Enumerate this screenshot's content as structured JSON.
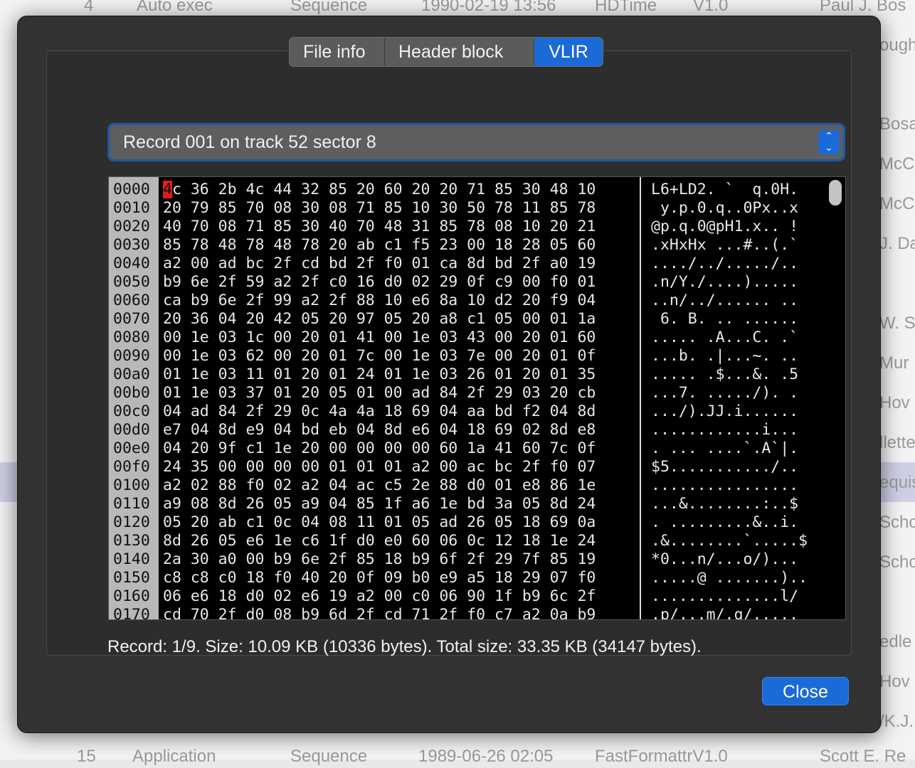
{
  "background_window": {
    "top_row": [
      "4",
      "Auto exec",
      "Sequence",
      "1990-02-19 13:56",
      "HDTime",
      "V1.0",
      "Paul J. Bos"
    ],
    "bottom_row": [
      "15",
      "Application",
      "Sequence",
      "1989-06-26 02:05",
      "FastFormattrV1.0",
      "Scott E. Re"
    ],
    "right_fragments": [
      "ough",
      "Bosa",
      "McCo",
      "McCo",
      "J. Da",
      "W. S",
      "Mur",
      "Hov",
      "llette",
      "equis",
      "Scho",
      "Scho",
      "edle",
      "Hov",
      "/K.J."
    ]
  },
  "dialog": {
    "tabs": [
      {
        "label": "File info",
        "active": false
      },
      {
        "label": "Header block",
        "active": false
      },
      {
        "label": "VLIR",
        "active": true
      }
    ],
    "record_select": {
      "selected": "Record 001 on track 52 sector 8",
      "stepper_up": "⌃",
      "stepper_down": "⌄"
    },
    "hex": {
      "offsets": [
        "0000",
        "0010",
        "0020",
        "0030",
        "0040",
        "0050",
        "0060",
        "0070",
        "0080",
        "0090",
        "00a0",
        "00b0",
        "00c0",
        "00d0",
        "00e0",
        "00f0",
        "0100",
        "0110",
        "0120",
        "0130",
        "0140",
        "0150",
        "0160",
        "0170"
      ],
      "cursor_char": "4",
      "first_row_rest": "c 36 2b 4c 44 32 85 20 60 20 20 71 85 30 48 10",
      "bytes_rest": [
        "20 79 85 70 08 30 08 71 85 10 30 50 78 11 85 78",
        "40 70 08 71 85 30 40 70 48 31 85 78 08 10 20 21",
        "85 78 48 78 48 78 20 ab c1 f5 23 00 18 28 05 60",
        "a2 00 ad bc 2f cd bd 2f f0 01 ca 8d bd 2f a0 19",
        "b9 6e 2f 59 a2 2f c0 16 d0 02 29 0f c9 00 f0 01",
        "ca b9 6e 2f 99 a2 2f 88 10 e6 8a 10 d2 20 f9 04",
        "20 36 04 20 42 05 20 97 05 20 a8 c1 05 00 01 1a",
        "00 1e 03 1c 00 20 01 41 00 1e 03 43 00 20 01 60",
        "00 1e 03 62 00 20 01 7c 00 1e 03 7e 00 20 01 0f",
        "01 1e 03 11 01 20 01 24 01 1e 03 26 01 20 01 35",
        "01 1e 03 37 01 20 05 01 00 ad 84 2f 29 03 20 cb",
        "04 ad 84 2f 29 0c 4a 4a 18 69 04 aa bd f2 04 8d",
        "e7 04 8d e9 04 bd eb 04 8d e6 04 18 69 02 8d e8",
        "04 20 9f c1 1e 20 00 00 00 00 60 1a 41 60 7c 0f",
        "24 35 00 00 00 00 01 01 01 a2 00 ac bc 2f f0 07",
        "a2 02 88 f0 02 a2 04 ac c5 2e 88 d0 01 e8 86 1e",
        "a9 08 8d 26 05 a9 04 85 1f a6 1e bd 3a 05 8d 24",
        "05 20 ab c1 0c 04 08 11 01 05 ad 26 05 18 69 0a",
        "8d 26 05 e6 1e c6 1f d0 e0 60 06 0c 12 18 1e 24",
        "2a 30 a0 00 b9 6e 2f 85 18 b9 6f 2f 29 7f 85 19",
        "c8 c8 c0 18 f0 40 20 0f 09 b0 e9 a5 18 29 07 f0",
        "06 e6 18 d0 02 e6 19 a2 00 c0 06 90 1f b9 6c 2f",
        "cd 70 2f d0 08 b9 6d 2f cd 71 2f f0 c7 a2 0a b9"
      ],
      "ascii": [
        "L6+LD2. `  q.0H.",
        " y.p.0.q..0Px..x",
        "@p.q.0@pH1.x.. !",
        ".xHxHx ...#..(.`",
        "..../../...../..",
        ".n/Y./....).....",
        "..n/../...... ..",
        " 6. B. .. ......",
        "..... .A...C. .`",
        "...b. .|...~. ..",
        "..... .$...&. .5",
        "...7. ...../). .",
        ".../).JJ.i......",
        "............i...",
        ". ... ....`.A`|.",
        "$5.........../..",
        "................",
        "...&........:..$",
        ". .........&..i.",
        ".&........`.....$",
        "*0...n/...o/)...",
        ".....@ .......)..",
        "..............l/",
        ".p/...m/.q/....."
      ]
    },
    "status": "Record: 1/9. Size: 10.09 KB (10336 bytes). Total size: 33.35 KB (34147 bytes).",
    "close_label": "Close",
    "colors": {
      "accent": "#1a6bd8",
      "sheet_bg": "#323232",
      "cursor": "#e01b1b"
    }
  }
}
